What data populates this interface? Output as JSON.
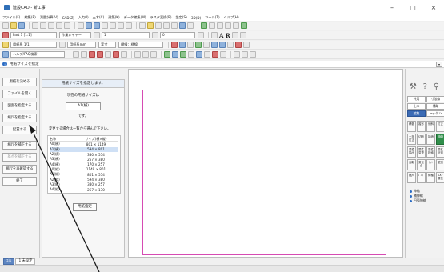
{
  "window": {
    "title": "建設CAD - 新工事",
    "minimize": "–",
    "maximize": "□",
    "close": "×"
  },
  "menu": [
    "ファイル(F)",
    "編集(E)",
    "測量計算(V)",
    "CAD(Z)",
    "入力(I)",
    "土木(C)",
    "建築(K)",
    "データ編集(M)",
    "ラスタ変換(R)",
    "設定(S)",
    "3D(D)",
    "ツール(T)",
    "ヘルプ(H)"
  ],
  "toolbar2": {
    "layer": "Part 1 [1:1]",
    "layer_mode": "作業レイヤー",
    "line_type": "1",
    "line_width": "0",
    "big_label": "A R"
  },
  "toolbar3": {
    "scale": "用紙系 1/1",
    "unit": "用紙系mm",
    "snap": "実寸",
    "style": "標線：標線"
  },
  "toolbar4": {
    "help": "ヘルプ/FAQ検索"
  },
  "status": {
    "icon": "info-icon",
    "message": "用紙サイズを指定",
    "drop": "▾"
  },
  "left_buttons": [
    {
      "label": "用紙を決める",
      "enabled": true
    },
    {
      "label": "ファイルを開く",
      "enabled": true
    },
    {
      "label": "図面を指定する",
      "enabled": true
    },
    {
      "label": "縮尺を指定する",
      "enabled": true
    },
    {
      "label": "配置する",
      "enabled": true
    },
    {
      "label": "縮尺を補正する",
      "enabled": true
    },
    {
      "label": "基点を補正する",
      "enabled": false
    },
    {
      "label": "縮尺を再確認する",
      "enabled": true
    },
    {
      "label": "終了",
      "enabled": true
    }
  ],
  "wizard": {
    "header": "用紙サイズを指定します。",
    "caption": "現在の用紙サイズは",
    "current": "A1(横)",
    "desu": "です。",
    "note": "変更する場合は一覧から選んで下さい。",
    "columns": [
      "名称",
      "サイズ(横×縦)"
    ],
    "rows": [
      {
        "name": "A0(横)",
        "size": "801 × 1149"
      },
      {
        "name": "A1(横)",
        "size": "594 × 801"
      },
      {
        "name": "A2(横)",
        "size": "380 × 554"
      },
      {
        "name": "A3(横)",
        "size": "257 × 380"
      },
      {
        "name": "A4(横)",
        "size": "170 × 257"
      },
      {
        "name": "A0(縦)",
        "size": "1149 × 801"
      },
      {
        "name": "A1(縦)",
        "size": "801 × 554"
      },
      {
        "name": "A2(縦)",
        "size": "594 × 380"
      },
      {
        "name": "A3(縦)",
        "size": "380 × 257"
      },
      {
        "name": "A4(縦)",
        "size": "257 × 170"
      }
    ],
    "selected_row": 1,
    "confirm": "用紙指定"
  },
  "right_panel": {
    "top_icons": [
      "hammer-icon",
      "help-icon",
      "search-icon"
    ],
    "top_glyphs": [
      "⚒",
      "?",
      "⚲"
    ],
    "tabs": [
      {
        "label": "共用",
        "active": false
      },
      {
        "label": "寸法線",
        "active": false
      },
      {
        "label": "土木",
        "active": false
      },
      {
        "label": "補助",
        "active": false
      },
      {
        "label": "編集",
        "active": true
      },
      {
        "label": "asp·ケシ",
        "active": false
      }
    ],
    "tools": [
      {
        "label": "移動",
        "active": false
      },
      {
        "label": "複写",
        "active": false
      },
      {
        "label": "傾斜",
        "active": false
      },
      {
        "label": "訂正",
        "active": false
      },
      {
        "label": "一括訂正",
        "active": false
      },
      {
        "label": "切断",
        "active": false
      },
      {
        "label": "接続",
        "active": false
      },
      {
        "label": "伸縮",
        "active": true
      },
      {
        "label": "属性抽出",
        "active": false
      },
      {
        "label": "属性変更",
        "active": false
      },
      {
        "label": "属性検索",
        "active": false
      },
      {
        "label": "属性分割",
        "active": false
      },
      {
        "label": "面取",
        "active": false
      },
      {
        "label": "変化点",
        "active": false
      },
      {
        "label": "ｶｯﾄ",
        "active": false
      },
      {
        "label": "塗別",
        "active": false
      },
      {
        "label": "縮尺",
        "active": false
      },
      {
        "label": "ﾀﾞﾝｸﾞ",
        "active": false
      },
      {
        "label": "線種",
        "active": false
      },
      {
        "label": "SXF属性",
        "active": false
      }
    ],
    "radios": [
      "伸縮",
      "補伸縮",
      "円弧伸縮"
    ]
  },
  "bottom": {
    "tabs": [
      "ｺﾐｭ",
      "1 未設定"
    ]
  },
  "colors": {
    "sheet_border": "#d64bb3",
    "accent": "#3b6bb5",
    "active_tool": "#2f8e4a"
  }
}
